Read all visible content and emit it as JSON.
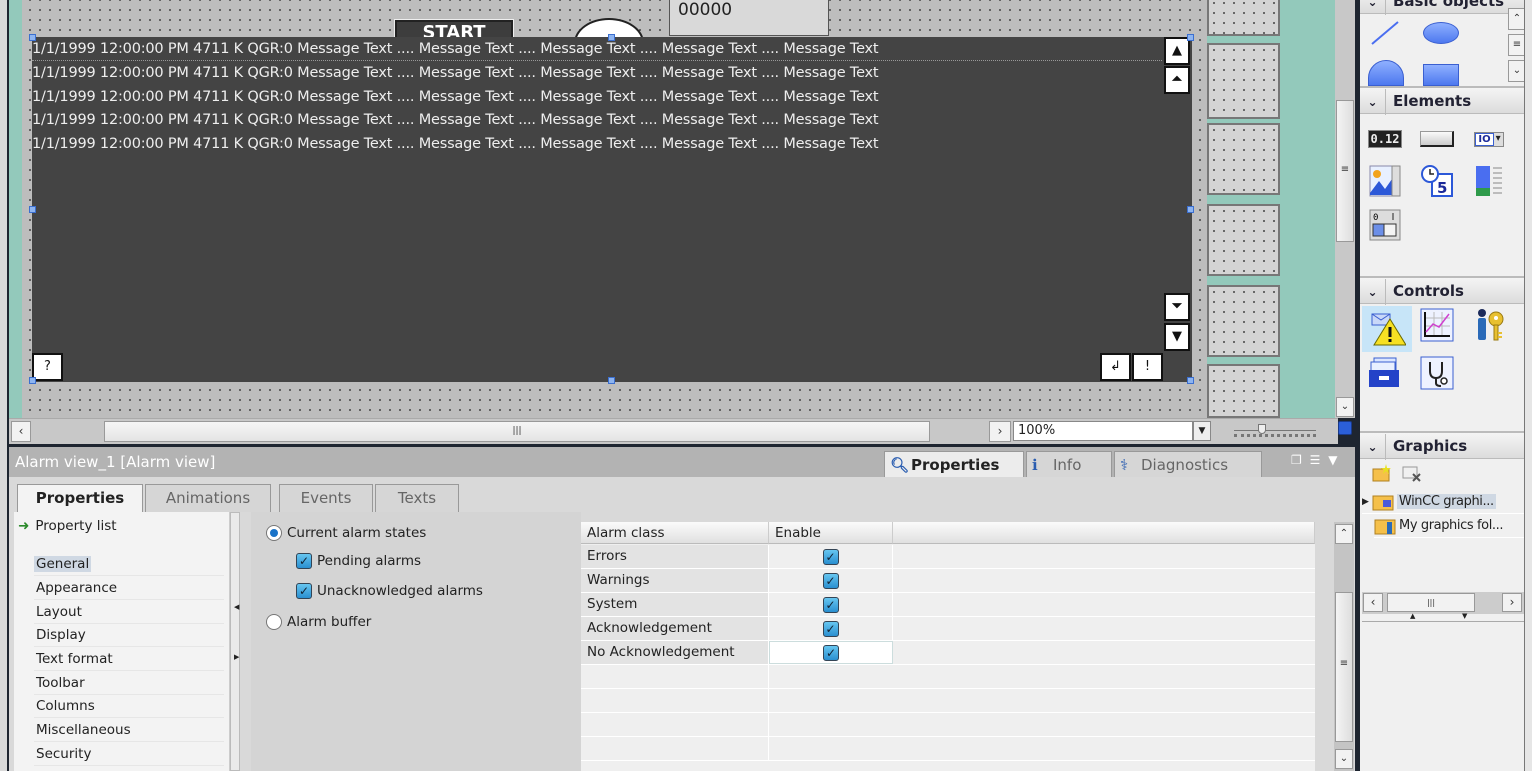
{
  "canvas": {
    "start_button_label": "START",
    "numeric_field_value": "00000",
    "alarm_messages": [
      "1/1/1999 12:00:00 PM  4711 K QGR:0 Message Text .... Message Text .... Message Text .... Message Text .... Message Text",
      "1/1/1999 12:00:00 PM  4711 K QGR:0 Message Text .... Message Text .... Message Text .... Message Text .... Message Text",
      "1/1/1999 12:00:00 PM  4711 K QGR:0 Message Text .... Message Text .... Message Text .... Message Text .... Message Text",
      "1/1/1999 12:00:00 PM  4711 K QGR:0 Message Text .... Message Text .... Message Text .... Message Text .... Message Text",
      "1/1/1999 12:00:00 PM  4711 K QGR:0 Message Text .... Message Text .... Message Text .... Message Text .... Message Text"
    ],
    "toolbar_buttons": {
      "help": "?",
      "loop_in_alarm": "↲",
      "acknowledge": "!",
      "scroll_up": "▲",
      "page_up": "⏶",
      "page_down": "⏷",
      "scroll_down": "▼"
    },
    "zoom_level": "100%"
  },
  "inspector": {
    "title": "Alarm view_1 [Alarm view]",
    "right_tabs": [
      {
        "label": "Properties",
        "active": true
      },
      {
        "label": "Info",
        "active": false
      },
      {
        "label": "Diagnostics",
        "active": false
      }
    ],
    "left_tabs": [
      {
        "label": "Properties",
        "active": true
      },
      {
        "label": "Animations",
        "active": false
      },
      {
        "label": "Events",
        "active": false
      },
      {
        "label": "Texts",
        "active": false
      }
    ],
    "property_list_label": "Property list",
    "property_items": [
      "General",
      "Appearance",
      "Layout",
      "Display",
      "Text format",
      "Toolbar",
      "Columns",
      "Miscellaneous",
      "Security"
    ],
    "selected_property": "General",
    "general": {
      "current_alarm_states_label": "Current alarm states",
      "current_alarm_states_selected": true,
      "pending_alarms_label": "Pending alarms",
      "pending_alarms_checked": true,
      "unacknowledged_alarms_label": "Unacknowledged alarms",
      "unacknowledged_alarms_checked": true,
      "alarm_buffer_label": "Alarm buffer",
      "alarm_buffer_selected": false
    },
    "alarm_class_table": {
      "headers": [
        "Alarm class",
        "Enable"
      ],
      "rows": [
        {
          "alarm_class": "Errors",
          "enabled": true
        },
        {
          "alarm_class": "Warnings",
          "enabled": true
        },
        {
          "alarm_class": "System",
          "enabled": true
        },
        {
          "alarm_class": "Acknowledgement",
          "enabled": true
        },
        {
          "alarm_class": "No Acknowledgement",
          "enabled": true
        }
      ]
    }
  },
  "palette": {
    "sections": {
      "basic_objects": "Basic objects",
      "elements": "Elements",
      "controls": "Controls",
      "graphics": "Graphics"
    },
    "elements_items": [
      "io-field",
      "button",
      "symbolic-io-field",
      "graphic-io-field",
      "date-time-field",
      "bar",
      "switch"
    ],
    "controls_items": [
      "alarm-view",
      "trend-view",
      "user-view",
      "recipe-view",
      "system-diagnostics-view"
    ],
    "selected_control": "alarm-view",
    "graphics_tree": [
      {
        "label": "WinCC graphi...",
        "selected": true,
        "expandable": true
      },
      {
        "label": "My graphics fol...",
        "selected": false,
        "expandable": false
      }
    ]
  }
}
